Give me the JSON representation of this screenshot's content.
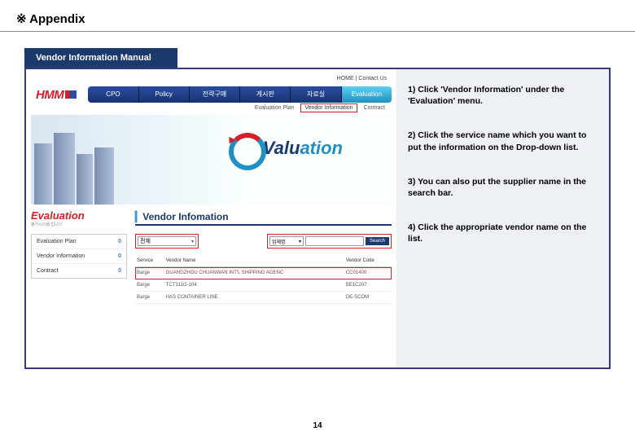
{
  "header": {
    "title": "※ Appendix"
  },
  "section": {
    "label": "Vendor Information Manual"
  },
  "screenshot": {
    "toplinks": "HOME  |  Contact Us",
    "logo": "HMM",
    "nav": {
      "items": [
        "CPO",
        "Policy",
        "전략구매",
        "게시판",
        "자료실"
      ],
      "eval": "Evaluation"
    },
    "subnav": {
      "items": [
        "Evaluation Plan",
        "Vendor Information",
        "Contract"
      ],
      "active_index": 1
    },
    "hero": {
      "text1": "Valu",
      "text2": "ation"
    },
    "sidebar": {
      "title": "Evaluation",
      "items": [
        {
          "label": "Evaluation Plan",
          "badge": "0"
        },
        {
          "label": "Vendor Information",
          "badge": "0"
        },
        {
          "label": "Contract",
          "badge": "0"
        }
      ]
    },
    "content": {
      "title": "Vendor Infomation",
      "dropdown_value": "전체",
      "search_select": "업체명",
      "search_button": "Search",
      "table": {
        "headers": [
          "Service",
          "Vendor Name",
          "Vendor Code"
        ],
        "rows": [
          {
            "service": "Barge",
            "vendor": "GUANGZHOU CHUANWAN INT'L SHIPPING AGENC",
            "code": "CC01400",
            "highlight": true
          },
          {
            "service": "Barge",
            "vendor": "TCT311G-104",
            "code": "BE1C207",
            "highlight": false
          },
          {
            "service": "Barge",
            "vendor": "HAS CONTAINER LINE",
            "code": "DE-SCOM",
            "highlight": false
          }
        ]
      }
    }
  },
  "instructions": {
    "step1": "1)  Click 'Vendor Information' under the 'Evaluation' menu.",
    "step2": "2) Click the service name which you want to put the information on the Drop-down list.",
    "step3": "3) You can also put the supplier name in the search bar.",
    "step4": "4) Click the appropriate vendor name on the list."
  },
  "page_number": "14"
}
